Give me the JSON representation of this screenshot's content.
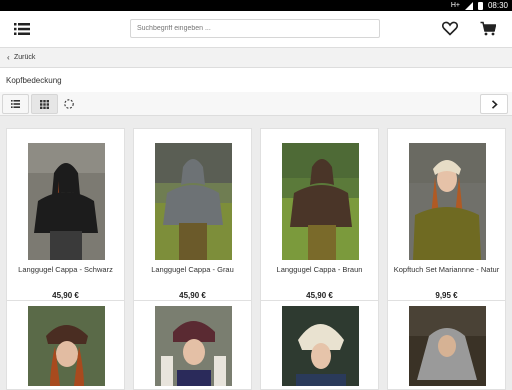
{
  "status": {
    "network": "H+",
    "time": "08:30"
  },
  "header": {
    "search_placeholder": "Suchbegriff eingeben ..."
  },
  "nav": {
    "back_label": "Zurück"
  },
  "category": {
    "title": "Kopfbedeckung"
  },
  "products": [
    {
      "name": "Langgugel Cappa - Schwarz",
      "price": "45,90 €",
      "color": "#1c1c1c"
    },
    {
      "name": "Langgugel Cappa - Grau",
      "price": "45,90 €",
      "color": "#6d7275"
    },
    {
      "name": "Langgugel Cappa - Braun",
      "price": "45,90 €",
      "color": "#4a3528"
    },
    {
      "name": "Kopftuch Set Mariannne - Natur",
      "price": "9,95 €",
      "color": "#e6dcc6"
    },
    {
      "name": "",
      "price": "",
      "color": "#4a2d22"
    },
    {
      "name": "",
      "price": "",
      "color": "#5a2a32"
    },
    {
      "name": "",
      "price": "",
      "color": "#e9e2d0"
    },
    {
      "name": "",
      "price": "",
      "color": "#9a9a9a"
    }
  ]
}
